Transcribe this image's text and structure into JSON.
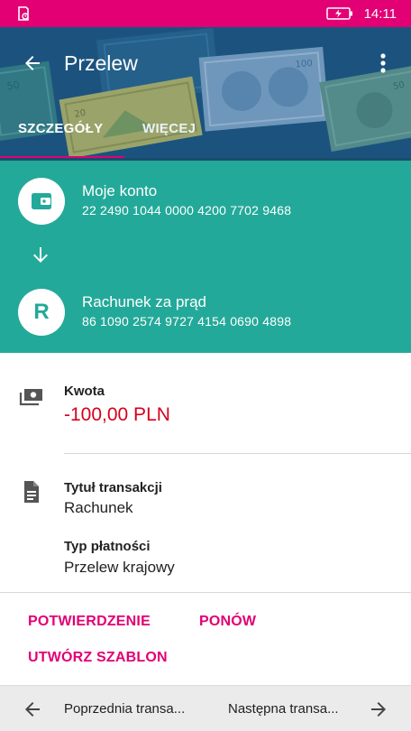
{
  "status_bar": {
    "time": "14:11",
    "battery_icon": "battery-charging-icon",
    "left_icon": "notification-icon"
  },
  "header": {
    "title": "Przelew",
    "back_icon": "arrow-back-icon",
    "menu_icon": "more-vert-icon"
  },
  "tabs": [
    {
      "label": "SZCZEGÓŁY",
      "active": true
    },
    {
      "label": "WIĘCEJ",
      "active": false
    }
  ],
  "from_account": {
    "name": "Moje konto",
    "number": "22 2490 1044 0000 4200 7702 9468",
    "icon": "wallet-icon"
  },
  "to_account": {
    "name": "Rachunek za prąd",
    "number": "86 1090 2574 9727 4154 0690 4898",
    "initial": "R"
  },
  "amount": {
    "label": "Kwota",
    "value": "-100,00 PLN"
  },
  "transaction": {
    "title_label": "Tytuł transakcji",
    "title_value": "Rachunek",
    "type_label": "Typ płatności",
    "type_value": "Przelew krajowy"
  },
  "actions": {
    "confirmation": "POTWIERDZENIE",
    "repeat": "PONÓW",
    "create_template": "UTWÓRZ SZABLON"
  },
  "bottom_nav": {
    "prev": "Poprzednia transa...",
    "next": "Następna transa..."
  },
  "colors": {
    "brand": "#e20074",
    "teal": "#23a999",
    "amount_negative": "#d6001c",
    "header_bg": "#205f87"
  }
}
